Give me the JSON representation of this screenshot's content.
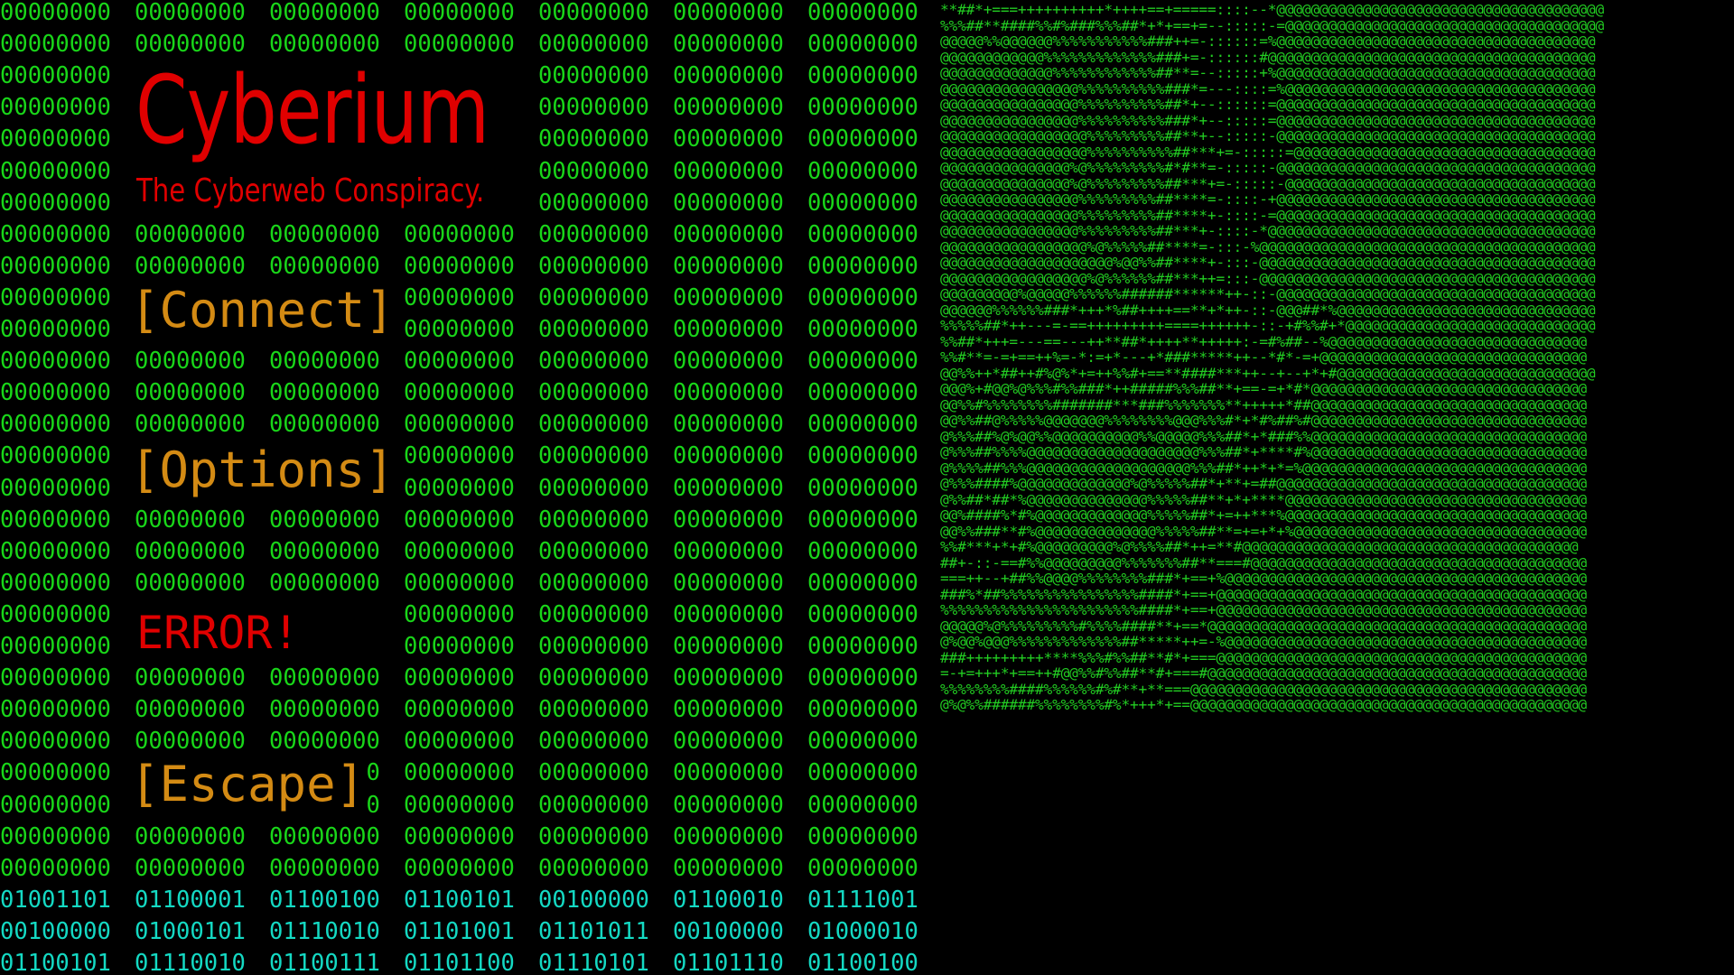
{
  "game": {
    "title": "Cyberium",
    "subtitle": "The Cyberweb Conspiracy.",
    "error_text": "ERROR!"
  },
  "menu": {
    "connect_label": "[Connect]",
    "options_label": "[Options]",
    "escape_label": "[Escape]"
  },
  "binary_background": {
    "filler_rows": 28,
    "filler_cell": "00000000",
    "message_rows": [
      [
        "01001101",
        "01100001",
        "01100100",
        "01100101",
        "00100000",
        "01100010",
        "01111001"
      ],
      [
        "00100000",
        "01000101",
        "01110010",
        "01101001",
        "01101011",
        "00100000",
        "01000010"
      ],
      [
        "01100101",
        "01110010",
        "01100111",
        "01101100",
        "01110101",
        "01101110",
        "01100100"
      ]
    ]
  },
  "ascii_art": [
    "**##*+===++++++++++*++++==+=====::::--*@@@@@@@@@@@@@@@@@@@@@@@@@@@@@@@@@@@@@@",
    "%%%##**####%%#%###%%%##*+*+==+=--:::::-=@@@@@@@@@@@@@@@@@@@@@@@@@@@@@@@@@@@@@",
    "@@@@@%%@@@@@@%%%%%%%%%%%###++=-::::::=%@@@@@@@@@@@@@@@@@@@@@@@@@@@@@@@@@@@@@",
    "@@@@@@@@@@@@%%%%%%%%%%%%%###+=-::::::#@@@@@@@@@@@@@@@@@@@@@@@@@@@@@@@@@@@@@@",
    "@@@@@@@@@@@@@%%%%%%%%%%%%##**=--:::::+%@@@@@@@@@@@@@@@@@@@@@@@@@@@@@@@@@@@@@",
    "@@@@@@@@@@@@@@@@%%%%%%%%%%###*=---::::=%@@@@@@@@@@@@@@@@@@@@@@@@@@@@@@@@@@@@",
    "@@@@@@@@@@@@@@@@%%%%%%%%%%##*+--::::::=@@@@@@@@@@@@@@@@@@@@@@@@@@@@@@@@@@@@@",
    "@@@@@@@@@@@@@@@@%%%%%%%%%%###*+--:::::=@@@@@@@@@@@@@@@@@@@@@@@@@@@@@@@@@@@@@",
    "@@@@@@@@@@@@@@@@@%%%%%%%%%##**+--:::::-@@@@@@@@@@@@@@@@@@@@@@@@@@@@@@@@@@@@@",
    "@@@@@@@@@@@@@@@@@%%%%%%%%%%##***+=-:::::=@@@@@@@@@@@@@@@@@@@@@@@@@@@@@@@@@@@",
    "@@@@@@@@@@@@@@@%@%%%%%%%%%#*#**=-:::::-@@@@@@@@@@@@@@@@@@@@@@@@@@@@@@@@@@@@@",
    "@@@@@@@@@@@@@@@%@%%%%%%%%%##***+=-:::::-@@@@@@@@@@@@@@@@@@@@@@@@@@@@@@@@@@@@",
    "@@@@@@@@@@@@@@@@%%%%%%%%%##****=-::::-+@@@@@@@@@@@@@@@@@@@@@@@@@@@@@@@@@@@@@",
    "@@@@@@@@@@@@@@@@%%%%%%%%%##****+-::::-=@@@@@@@@@@@@@@@@@@@@@@@@@@@@@@@@@@@@@",
    "@@@@@@@@@@@@@@@@%%%%%%%%%##***+-::::-*@@@@@@@@@@@@@@@@@@@@@@@@@@@@@@@@@@@@@@",
    "@@@@@@@@@@@@@@@@@%@%%%%%##****=-:::-%@@@@@@@@@@@@@@@@@@@@@@@@@@@@@@@@@@@@@@@",
    "@@@@@@@@@@@@@@@@@@@@%@@%%##****+-:::-@@@@@@@@@@@@@@@@@@@@@@@@@@@@@@@@@@@@@@@",
    "@@@@@@@@@@@@@@@@@%@%%%%%%##***++=:::-@@@@@@@@@@@@@@@@@@@@@@@@@@@@@@@@@@@@@@@",
    "@@@@@@@@@%@@@@@%%%%%%######******++-::-@@@@@@@@@@@@@@@@@@@@@@@@@@@@@@@@@@@@@",
    "@@@@@@%%%%%%###*+++*%##++++==**+*++-::-@@@##*%@@@@@@@@@@@@@@@@@@@@@@@@@@@@@@",
    "%%%%%##*++---=-==+++++++++====++++++-::-+#%%#+*@@@@@@@@@@@@@@@@@@@@@@@@@@@@@",
    "%%##*+++=---==---++**##*++++**+++++:-=#%##--%@@@@@@@@@@@@@@@@@@@@@@@@@@@@@@",
    "%%#**=-=+==++%=-*:=+*---+*###*****++--*#*-=+@@@@@@@@@@@@@@@@@@@@@@@@@@@@@@@",
    "@@%%++*##++#%@%*+=++%%#+==**####***++--+--+*+#@@@@@@@@@@@@@@@@@@@@@@@@@@@@@@",
    "@@@%+#@@%@%%%#%%###*++#####%%%##**+==-=+*#*@@@@@@@@@@@@@@@@@@@@@@@@@@@@@@@@",
    "@@%%#%%%%%%%%#######***###%%%%%%%**+++++*##@@@@@@@@@@@@@@@@@@@@@@@@@@@@@@@@",
    "@@%%##@%%%%%@@@@@@@%%%%%%%%@@@%%%#*+*#%##%#@@@@@@@@@@@@@@@@@@@@@@@@@@@@@@@@",
    "@%%%##%@%@@%%@@@@@@@@@@%%@@@@@%%%##*+*###%%@@@@@@@@@@@@@@@@@@@@@@@@@@@@@@@@",
    "@%%%##%%%%@@@@@@@@@@@@@@@@@@@@%%%##*+****#%@@@@@@@@@@@@@@@@@@@@@@@@@@@@@@@@",
    "@%%%%##%%%@@@@@@@@@@@@@@@@@@@%%%##*++*+*=%@@@@@@@@@@@@@@@@@@@@@@@@@@@@@@@@@",
    "@%%%####%@@@@@@@@@@@@@%@%%%%%##*+**+=##@@@@@@@@@@@@@@@@@@@@@@@@@@@@@@@@@@@@",
    "@%%##*##*%@@@@@@@@@@@@@@%%%%%##**+*+****@@@@@@@@@@@@@@@@@@@@@@@@@@@@@@@@@@@",
    "@@%####%*#%@@@@@@@@@@@@@%%%%%##*+=++***%@@@@@@@@@@@@@@@@@@@@@@@@@@@@@@@@@@@",
    "@@%%###**#%@@@@@@@@@@@@@@%%%%%##**=+=+*+%@@@@@@@@@@@@@@@@@@@@@@@@@@@@@@@@@@",
    "%%#***+*+#%@@@@@@@@@%@%%%%##*++=**#@@@@@@@@@@@@@@@@@@@@@@@@@@@@@@@@@@@@@@@",
    "##+-::-==#%%@@@@@@@@@%%%%%%%##**===#@@@@@@@@@@@@@@@@@@@@@@@@@@@@@@@@@@@@@@@",
    "===++--+##%%@@@@%%%%%%%%###*+==+%@@@@@@@@@@@@@@@@@@@@@@@@@@@@@@@@@@@@@@@@@@",
    "###%*##%%%%%%%%%%%%%%%%####*+==+@@@@@@@@@@@@@@@@@@@@@@@@@@@@@@@@@@@@@@@@@@@",
    "%%%%%%%%%%%%%%%%%%%%%%%####*+==+@@@@@@@@@@@@@@@@@@@@@@@@@@@@@@@@@@@@@@@@@@@",
    "@@@@@%@%%%%%%%%%#%%%%####**+==*@@@@@@@@@@@@@@@@@@@@@@@@@@@@@@@@@@@@@@@@@@@@",
    "@%@@%@@@%%%%%%%%%%%%%##*****++=-%@@@@@@@@@@@@@@@@@@@@@@@@@@@@@@@@@@@@@@@@@@",
    "###+++++++++****%%%#%%##**#*+===@@@@@@@@@@@@@@@@@@@@@@@@@@@@@@@@@@@@@@@@@@@",
    "=-+=+++*+==++#@@%%#%%##**#+===#@@@@@@@@@@@@@@@@@@@@@@@@@@@@@@@@@@@@@@@@@@@@",
    "%%%%%%%%####%%%%%%#%#**+**===@@@@@@@@@@@@@@@@@@@@@@@@@@@@@@@@@@@@@@@@@@@@@@",
    "@%@%%######%%%%%%%%#%*+++*+==@@@@@@@@@@@@@@@@@@@@@@@@@@@@@@@@@@@@@@@@@@@@@@"
  ],
  "colors": {
    "background": "#000000",
    "binary_green": "#19d619",
    "binary_cyan": "#14d9c3",
    "title_red": "#e00000",
    "menu_orange": "#d48b14",
    "art_green": "#22cc22"
  }
}
